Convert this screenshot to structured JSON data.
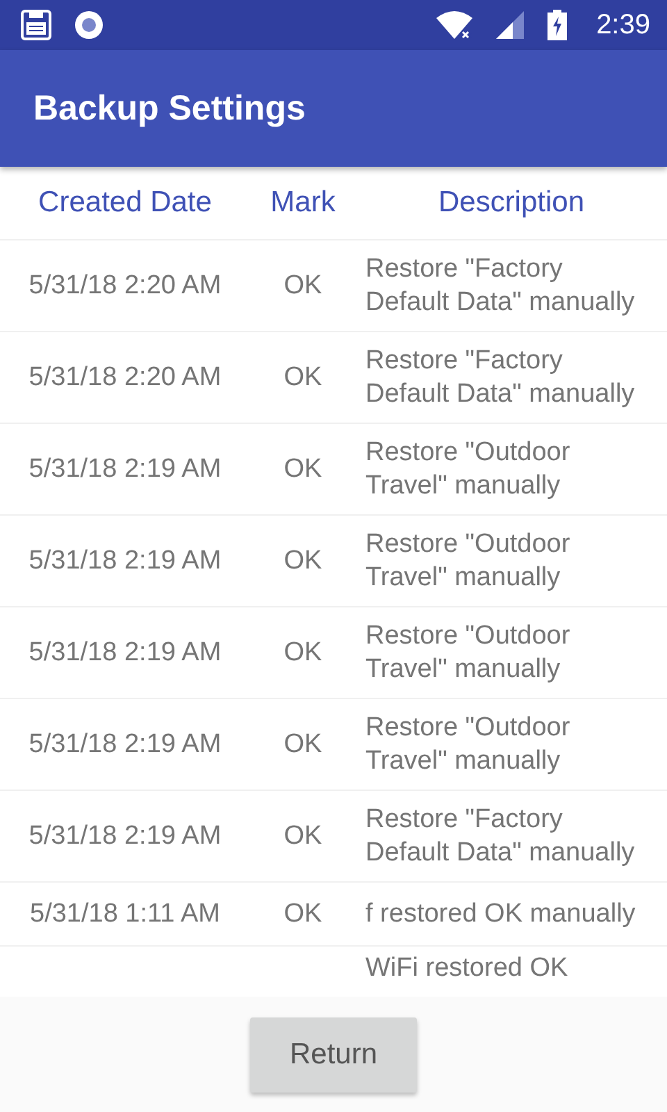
{
  "status_bar": {
    "time": "2:39"
  },
  "app_bar": {
    "title": "Backup Settings"
  },
  "table": {
    "columns": [
      "Created Date",
      "Mark",
      "Description"
    ],
    "rows": [
      {
        "date": "5/31/18 2:20 AM",
        "mark": "OK",
        "description": "Restore \"Factory Default Data\" manually"
      },
      {
        "date": "5/31/18 2:20 AM",
        "mark": "OK",
        "description": "Restore \"Factory Default Data\" manually"
      },
      {
        "date": "5/31/18 2:19 AM",
        "mark": "OK",
        "description": "Restore \"Outdoor Travel\" manually"
      },
      {
        "date": "5/31/18 2:19 AM",
        "mark": "OK",
        "description": "Restore \"Outdoor Travel\" manually"
      },
      {
        "date": "5/31/18 2:19 AM",
        "mark": "OK",
        "description": "Restore \"Outdoor Travel\" manually"
      },
      {
        "date": "5/31/18 2:19 AM",
        "mark": "OK",
        "description": "Restore \"Outdoor Travel\" manually"
      },
      {
        "date": "5/31/18 2:19 AM",
        "mark": "OK",
        "description": "Restore \"Factory Default Data\" manually"
      },
      {
        "date": "5/31/18 1:11 AM",
        "mark": "OK",
        "description": "f restored OK manually"
      },
      {
        "description": "WiFi  restored OK"
      }
    ]
  },
  "button": {
    "label": "Return"
  }
}
